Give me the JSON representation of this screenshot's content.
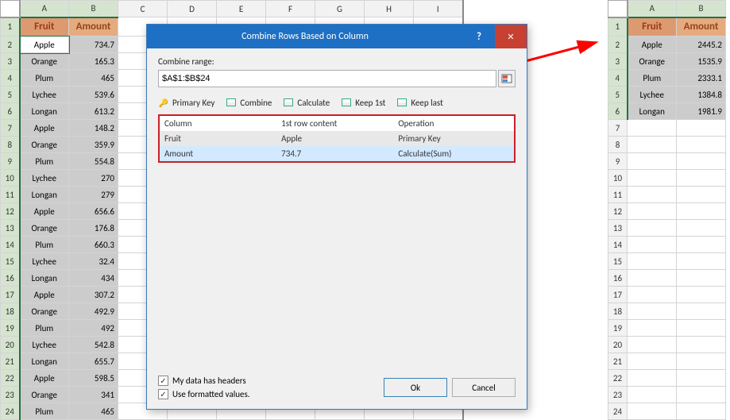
{
  "sheet1": {
    "colLetters": [
      "A",
      "B",
      "C",
      "D",
      "E",
      "F",
      "G",
      "H",
      "I"
    ],
    "activeCols": [
      "A",
      "B"
    ],
    "activeCell": "A2",
    "header": [
      "Fruit",
      "Amount"
    ],
    "rows": [
      [
        "Apple",
        "734.7"
      ],
      [
        "Orange",
        "165.3"
      ],
      [
        "Plum",
        "465"
      ],
      [
        "Lychee",
        "539.6"
      ],
      [
        "Longan",
        "613.2"
      ],
      [
        "Apple",
        "148.2"
      ],
      [
        "Orange",
        "359.9"
      ],
      [
        "Plum",
        "554.8"
      ],
      [
        "Lychee",
        "270"
      ],
      [
        "Longan",
        "279"
      ],
      [
        "Apple",
        "656.6"
      ],
      [
        "Orange",
        "176.8"
      ],
      [
        "Plum",
        "660.3"
      ],
      [
        "Lychee",
        "32.4"
      ],
      [
        "Longan",
        "434"
      ],
      [
        "Apple",
        "307.2"
      ],
      [
        "Orange",
        "492.9"
      ],
      [
        "Plum",
        "492"
      ],
      [
        "Lychee",
        "542.8"
      ],
      [
        "Longan",
        "655.7"
      ],
      [
        "Apple",
        "598.5"
      ],
      [
        "Orange",
        "341"
      ],
      [
        "Plum",
        "465"
      ]
    ]
  },
  "sheet2": {
    "colLetters": [
      "A",
      "B"
    ],
    "header": [
      "Fruit",
      "Amount"
    ],
    "dataRows": [
      [
        "Apple",
        "2445.2"
      ],
      [
        "Orange",
        "1535.9"
      ],
      [
        "Plum",
        "2333.1"
      ],
      [
        "Lychee",
        "1384.8"
      ],
      [
        "Longan",
        "1981.9"
      ]
    ],
    "emptyRows": 18
  },
  "dialog": {
    "title": "Combine Rows Based on Column",
    "rangeLabel": "Combine range:",
    "rangeValue": "$A$1:$B$24",
    "tools": {
      "pk": "Primary Key",
      "combine": "Combine",
      "calc": "Calculate",
      "keep1": "Keep 1st",
      "keepL": "Keep last"
    },
    "gridHead": {
      "c1": "Column",
      "c2": "1st row content",
      "c3": "Operation"
    },
    "gridRows": [
      [
        "Fruit",
        "Apple",
        "Primary Key"
      ],
      [
        "Amount",
        "734.7",
        "Calculate(Sum)"
      ]
    ],
    "chk1": "My data has headers",
    "chk2": "Use formatted values.",
    "ok": "Ok",
    "cancel": "Cancel"
  }
}
